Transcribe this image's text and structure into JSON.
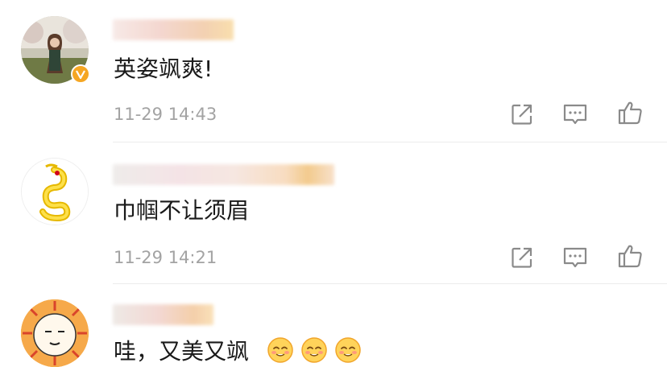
{
  "comments": [
    {
      "text": "英姿飒爽!",
      "time": "11-29 14:43",
      "verified": true,
      "avatar": "woman-in-park-avatar"
    },
    {
      "text": "巾帼不让须眉",
      "time": "11-29 14:21",
      "verified": false,
      "avatar": "golden-dragon-avatar"
    },
    {
      "text": "哇，又美又飒",
      "time": "",
      "verified": false,
      "avatar": "cartoon-sun-face-avatar",
      "emoji_count": 3
    }
  ],
  "icons": {
    "share": "share-icon",
    "comment": "comment-icon",
    "like": "like-icon",
    "emoji": "blush-emoji-icon",
    "badge": "verified-badge-icon"
  },
  "colors": {
    "text": "#1a1a1a",
    "time": "#a3a3a3",
    "icon": "#8a8a8a",
    "badge": "#f5a623",
    "divider": "#ececec"
  }
}
